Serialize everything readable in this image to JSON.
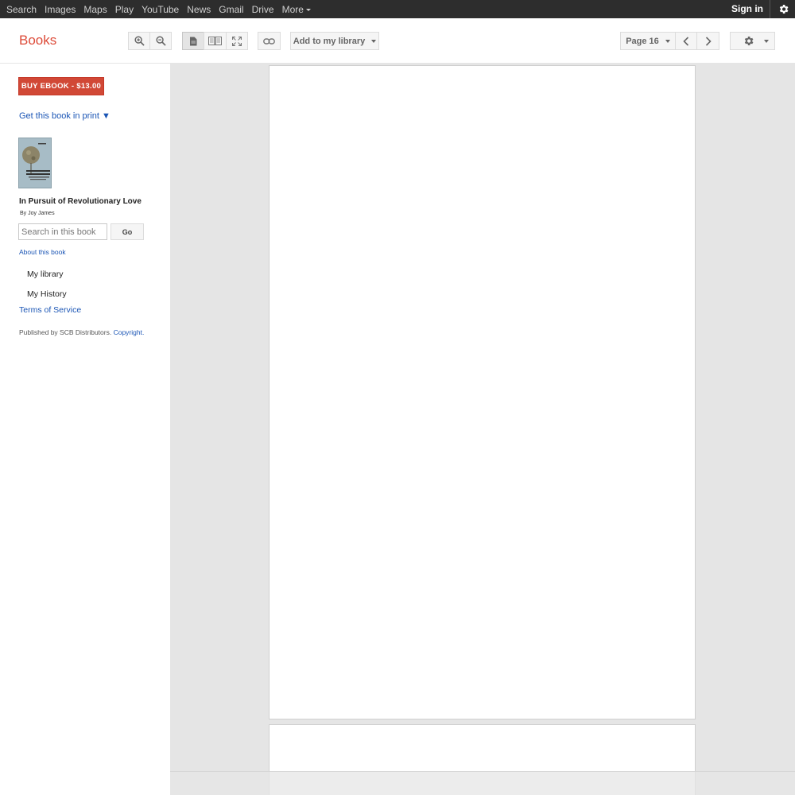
{
  "topbar": {
    "links": [
      "Search",
      "Images",
      "Maps",
      "Play",
      "YouTube",
      "News",
      "Gmail",
      "Drive",
      "More"
    ],
    "signin": "Sign in",
    "gear_icon": "gear-icon"
  },
  "toolbar": {
    "brand": "Books",
    "add_library": "Add to my library",
    "page_label": "Page 16",
    "icons": [
      "zoom-in-icon",
      "zoom-out-icon",
      "single-page-icon",
      "two-page-icon",
      "fullscreen-icon",
      "link-icon",
      "chevron-left-icon",
      "chevron-right-icon",
      "gear-icon"
    ]
  },
  "sidebar": {
    "buy_label": "BUY EBOOK - $13.00",
    "print_link": "Get this book in print ▼",
    "book_title": "In Pursuit of Revolutionary Love",
    "author": "By Joy James",
    "search_placeholder": "Search in this book",
    "go_label": "Go",
    "about": "About this book",
    "my_library": "My library",
    "my_history": "My History",
    "terms": "Terms of Service",
    "published_prefix": "Published by SCB Distributors.",
    "copyright": "Copyright."
  },
  "colors": {
    "topbar_bg": "#2d2d2d",
    "brand": "#dd4b39",
    "buy_button": "#d14836",
    "link": "#1a55b5",
    "viewer_bg": "#e5e5e5"
  }
}
